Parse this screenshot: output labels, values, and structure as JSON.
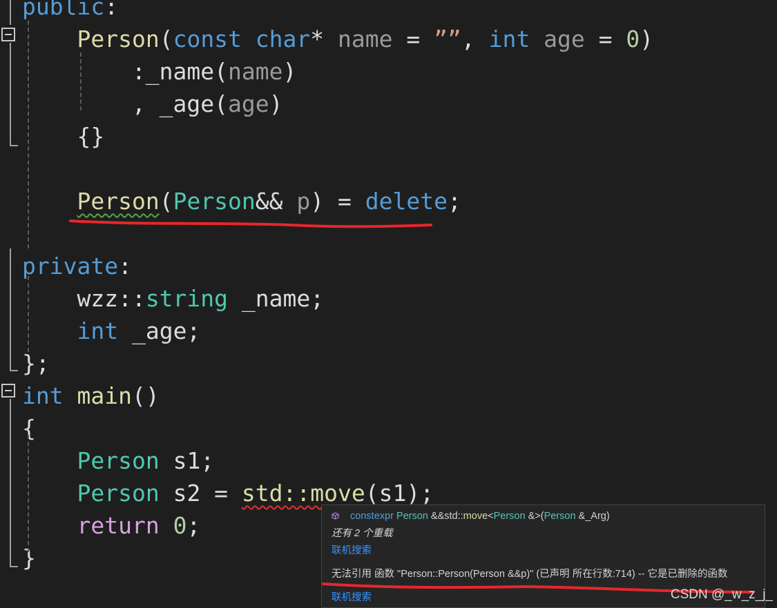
{
  "editor": {
    "lines": [
      {
        "tokens": [
          {
            "t": "public",
            "c": "kw"
          },
          {
            "t": ":",
            "c": "op"
          }
        ]
      },
      {
        "tokens": [
          {
            "t": "    "
          },
          {
            "t": "Person",
            "c": "fn"
          },
          {
            "t": "("
          },
          {
            "t": "const",
            "c": "kw"
          },
          {
            "t": " "
          },
          {
            "t": "char",
            "c": "kw"
          },
          {
            "t": "* "
          },
          {
            "t": "name",
            "c": "pm"
          },
          {
            "t": " = "
          },
          {
            "t": "””",
            "c": "str"
          },
          {
            "t": ", "
          },
          {
            "t": "int",
            "c": "kw"
          },
          {
            "t": " "
          },
          {
            "t": "age",
            "c": "pm"
          },
          {
            "t": " = "
          },
          {
            "t": "0",
            "c": "num"
          },
          {
            "t": ")"
          }
        ]
      },
      {
        "tokens": [
          {
            "t": "        :_name("
          },
          {
            "t": "name",
            "c": "pm"
          },
          {
            "t": ")"
          }
        ]
      },
      {
        "tokens": [
          {
            "t": "        , _age("
          },
          {
            "t": "age",
            "c": "pm"
          },
          {
            "t": ")"
          }
        ]
      },
      {
        "tokens": [
          {
            "t": "    {}"
          }
        ]
      },
      {
        "tokens": []
      },
      {
        "tokens": [
          {
            "t": "    "
          },
          {
            "t": "Person",
            "c": "fn",
            "sq": "green"
          },
          {
            "t": "("
          },
          {
            "t": "Person",
            "c": "ty"
          },
          {
            "t": "&& "
          },
          {
            "t": "p",
            "c": "pm"
          },
          {
            "t": ") = "
          },
          {
            "t": "delete",
            "c": "kw"
          },
          {
            "t": ";"
          }
        ]
      },
      {
        "tokens": []
      },
      {
        "tokens": [
          {
            "t": "private",
            "c": "kw"
          },
          {
            "t": ":"
          }
        ]
      },
      {
        "tokens": [
          {
            "t": "    wzz::"
          },
          {
            "t": "string",
            "c": "ty"
          },
          {
            "t": " _name;"
          }
        ]
      },
      {
        "tokens": [
          {
            "t": "    "
          },
          {
            "t": "int",
            "c": "kw"
          },
          {
            "t": " _age;"
          }
        ]
      },
      {
        "tokens": [
          {
            "t": "};"
          }
        ]
      },
      {
        "tokens": [
          {
            "t": "int",
            "c": "kw"
          },
          {
            "t": " "
          },
          {
            "t": "main",
            "c": "fn"
          },
          {
            "t": "()"
          }
        ]
      },
      {
        "tokens": [
          {
            "t": "{"
          }
        ]
      },
      {
        "tokens": [
          {
            "t": "    "
          },
          {
            "t": "Person",
            "c": "ty"
          },
          {
            "t": " s1;"
          }
        ]
      },
      {
        "tokens": [
          {
            "t": "    "
          },
          {
            "t": "Person",
            "c": "ty"
          },
          {
            "t": " s2 = "
          },
          {
            "t": "std::move",
            "c": "fn",
            "sq": "red"
          },
          {
            "t": "(s1);"
          }
        ]
      },
      {
        "tokens": [
          {
            "t": "    "
          },
          {
            "t": "return",
            "c": "pp"
          },
          {
            "t": " "
          },
          {
            "t": "0",
            "c": "num"
          },
          {
            "t": ";"
          }
        ]
      },
      {
        "tokens": [
          {
            "t": "}"
          }
        ]
      }
    ]
  },
  "tooltip": {
    "signature": {
      "icon": "cube-icon",
      "parts": [
        {
          "t": "constexpr ",
          "c": "kw"
        },
        {
          "t": "Person ",
          "c": "ty"
        },
        {
          "t": "&&std::",
          "c": "plain"
        },
        {
          "t": "move",
          "c": "fn"
        },
        {
          "t": "<",
          "c": "plain"
        },
        {
          "t": "Person ",
          "c": "ty"
        },
        {
          "t": "&>(",
          "c": "plain"
        },
        {
          "t": "Person ",
          "c": "ty"
        },
        {
          "t": "&_Arg)",
          "c": "plain"
        }
      ]
    },
    "overloads": "还有 2 个重载",
    "search_link_1": "联机搜索",
    "error_message": "无法引用 函数 \"Person::Person(Person &&p)\" (已声明 所在行数:714) -- 它是已删除的函数",
    "search_link_2": "联机搜索"
  },
  "watermark": "CSDN @_w_z_j_",
  "colors": {
    "background": "#1e1e1e",
    "keyword": "#569cd6",
    "type": "#4ec9b0",
    "function": "#dcdcaa",
    "parameter": "#9a9a9a",
    "control": "#d8a0df",
    "number": "#b5cea8",
    "annotation_red": "#e8262b",
    "link": "#3794ff"
  }
}
